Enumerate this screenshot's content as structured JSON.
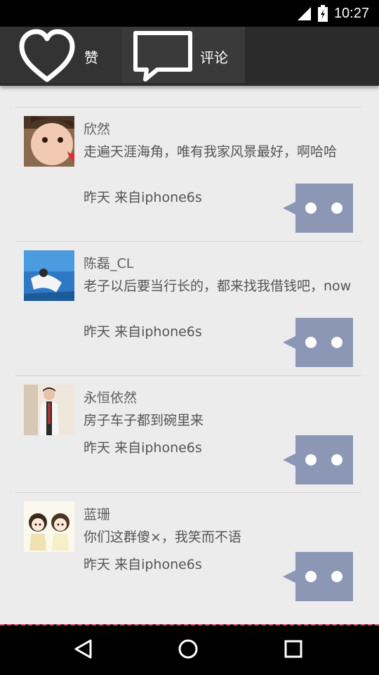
{
  "status_bar": {
    "time": "10:27",
    "icons": [
      "signal-icon",
      "battery-icon"
    ]
  },
  "tabs": [
    {
      "label": "赞",
      "icon": "heart-icon"
    },
    {
      "label": "评论",
      "icon": "comment-bubble-icon"
    }
  ],
  "comments": [
    {
      "name": "欣然",
      "text": "走遍天涯海角，唯有我家风景最好，啊哈哈",
      "time": "昨天",
      "source": "来自iphone6s"
    },
    {
      "name": "陈磊_CL",
      "text": "老子以后要当行长的，都来找我借钱吧，now",
      "time": "昨天",
      "source": "来自iphone6s"
    },
    {
      "name": "永恒依然",
      "text": "房子车子都到碗里来",
      "time": "昨天",
      "source": "来自iphone6s"
    },
    {
      "name": "蓝珊",
      "text": "你们这群傻×，我笑而不语",
      "time": "昨天",
      "source": "来自iphone6s"
    }
  ],
  "colors": {
    "reply_button": "#8c97b6",
    "toolbar": "#2b2b2b",
    "background": "#ececec"
  },
  "nav_bar": {
    "buttons": [
      "back-icon",
      "home-icon",
      "recents-icon"
    ]
  }
}
